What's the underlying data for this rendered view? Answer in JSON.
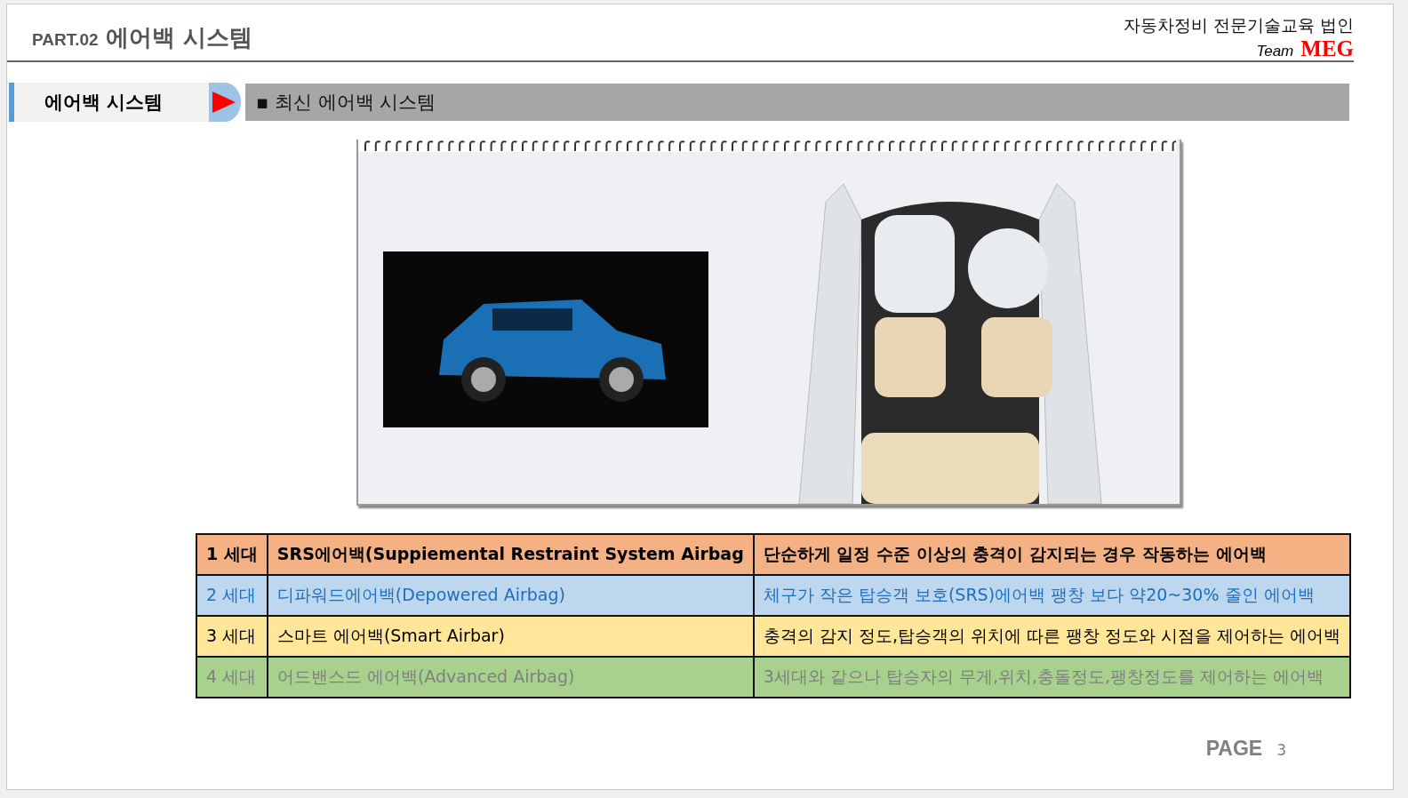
{
  "header": {
    "part": "PART.02",
    "title": "에어백 시스템",
    "org": "자동차정비 전문기술교육 법인",
    "team_label": "Team",
    "team_name": "MEG"
  },
  "section": {
    "label": "에어백 시스템",
    "heading": "▪ 최신 에어백 시스템"
  },
  "table": {
    "rows": [
      {
        "generation": "1 세대",
        "name": "SRS에어백(Suppiemental Restraint System Airbag",
        "description": "단순하게 일정 수준 이상의 충격이 감지되는 경우 작동하는 에어백",
        "color": "#f4b183",
        "kind": "emphasis"
      },
      {
        "generation": "2 세대",
        "name": "디파워드에어백(Depowered Airbag)",
        "description": "체구가 작은 탑승객 보호(SRS)에어백 팽창 보다 약20~30% 줄인 에어백",
        "color": "#bdd7ee",
        "kind": "accent"
      },
      {
        "generation": "3 세대",
        "name": "스마트 에어백(Smart Airbar)",
        "description": "충격의 감지 정도,탑승객의 위치에 따른 팽창 정도와 시점을 제어하는 에어백",
        "color": "#ffe699",
        "kind": "plain"
      },
      {
        "generation": "4 세대",
        "name": "어드밴스드 에어백(Advanced Airbag)",
        "description": "3세대와 같으나 탑승자의 무게,위치,충돌정도,팽창정도를 제어하는 에어백",
        "color": "#a9d18e",
        "kind": "muted"
      }
    ]
  },
  "footer": {
    "page_label": "PAGE",
    "page_number": "3"
  }
}
